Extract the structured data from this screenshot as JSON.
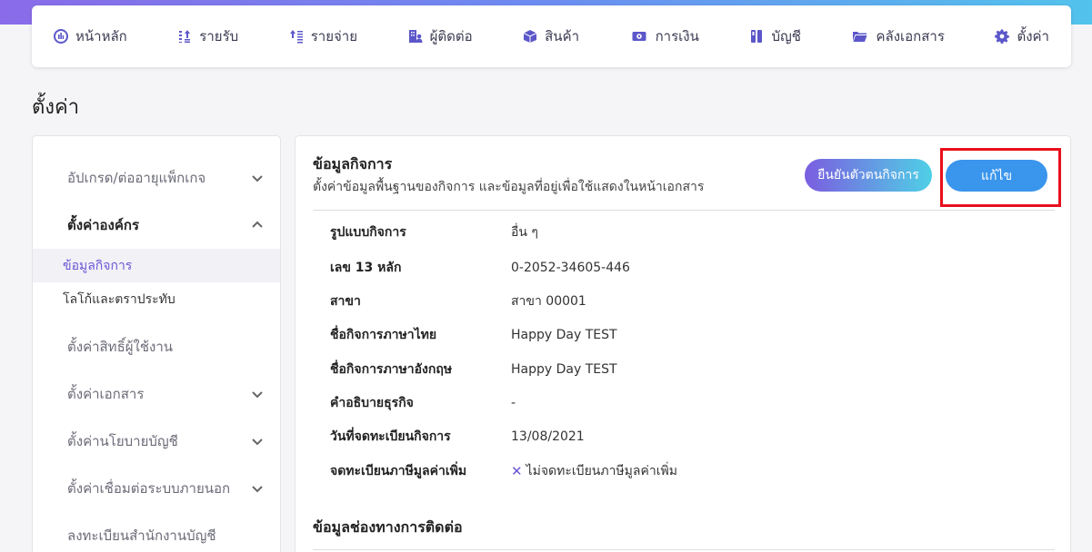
{
  "nav": {
    "items": [
      {
        "label": "หน้าหลัก",
        "icon": "dashboard-icon"
      },
      {
        "label": "รายรับ",
        "icon": "income-icon"
      },
      {
        "label": "รายจ่าย",
        "icon": "expense-icon"
      },
      {
        "label": "ผู้ติดต่อ",
        "icon": "contacts-icon"
      },
      {
        "label": "สินค้า",
        "icon": "box-icon"
      },
      {
        "label": "การเงิน",
        "icon": "money-icon"
      },
      {
        "label": "บัญชี",
        "icon": "ledger-icon"
      },
      {
        "label": "คลังเอกสาร",
        "icon": "folder-icon"
      },
      {
        "label": "ตั้งค่า",
        "icon": "gear-icon"
      }
    ]
  },
  "page_title": "ตั้งค่า",
  "sidebar": {
    "groups": [
      {
        "label": "อัปเกรด/ต่ออายุแพ็กเกจ",
        "chevron": "down"
      },
      {
        "label": "ตั้งค่าองค์กร",
        "chevron": "up"
      },
      {
        "label": "ตั้งค่าสิทธิ์ผู้ใช้งาน",
        "chevron": "none"
      },
      {
        "label": "ตั้งค่าเอกสาร",
        "chevron": "down"
      },
      {
        "label": "ตั้งค่านโยบายบัญชี",
        "chevron": "down"
      },
      {
        "label": "ตั้งค่าเชื่อมต่อระบบภายนอก",
        "chevron": "down"
      },
      {
        "label": "ลงทะเบียนสำนักงานบัญชี",
        "chevron": "none"
      }
    ],
    "sub_items": [
      {
        "label": "ข้อมูลกิจการ",
        "active": true
      },
      {
        "label": "โลโก้และตราประทับ",
        "active": false
      }
    ]
  },
  "card": {
    "title": "ข้อมูลกิจการ",
    "subtitle": "ตั้งค่าข้อมูลพื้นฐานของกิจการ และข้อมูลที่อยู่เพื่อใช้แสดงในหน้าเอกสาร",
    "verify_label": "ยืนยันตัวตนกิจการ",
    "edit_label": "แก้ไข",
    "rows": [
      {
        "label": "รูปแบบกิจการ",
        "value": "อื่น ๆ"
      },
      {
        "label": "เลข 13 หลัก",
        "value": "0-2052-34605-446"
      },
      {
        "label": "สาขา",
        "value": "สาขา 00001"
      },
      {
        "label": "ชื่อกิจการภาษาไทย",
        "value": "Happy Day TEST"
      },
      {
        "label": "ชื่อกิจการภาษาอังกฤษ",
        "value": "Happy Day TEST"
      },
      {
        "label": "คำอธิบายธุรกิจ",
        "value": "-"
      },
      {
        "label": "วันที่จดทะเบียนกิจการ",
        "value": "13/08/2021"
      },
      {
        "label": "จดทะเบียนภาษีมูลค่าเพิ่ม",
        "value": "ไม่จดทะเบียนภาษีมูลค่าเพิ่ม"
      }
    ],
    "section2_title": "ข้อมูลช่องทางการติดต่อ"
  },
  "colors": {
    "accent": "#6a56d6",
    "edit_button": "#3a95ec",
    "highlight": "#e8101c"
  }
}
